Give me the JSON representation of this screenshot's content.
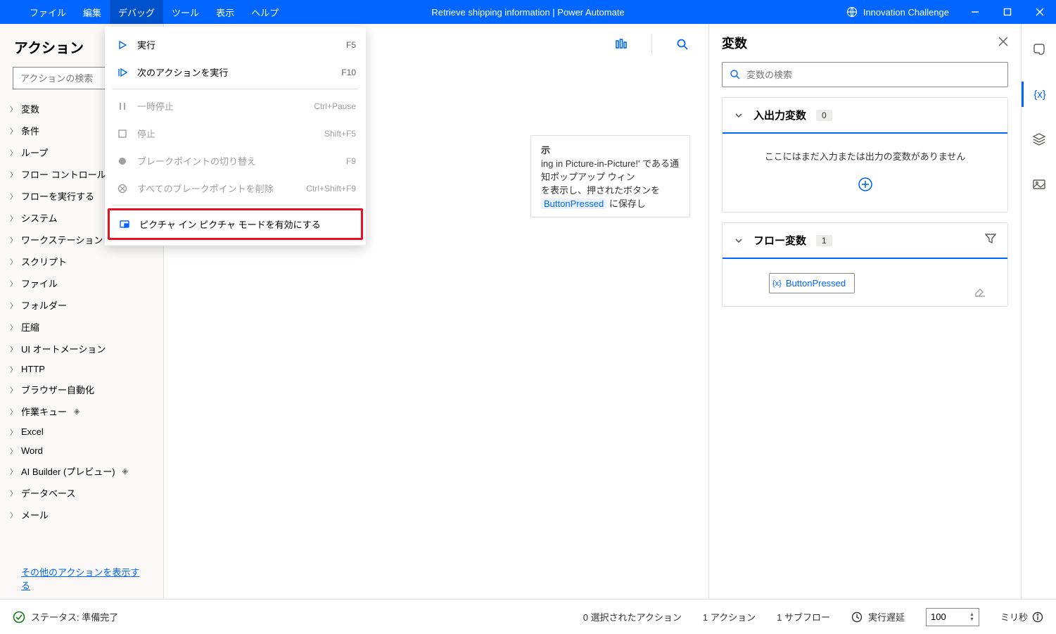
{
  "titlebar": {
    "menus": [
      "ファイル",
      "編集",
      "デバッグ",
      "ツール",
      "表示",
      "ヘルプ"
    ],
    "active_menu_index": 2,
    "title": "Retrieve shipping information | Power Automate",
    "environment": "Innovation Challenge"
  },
  "actions": {
    "title": "アクション",
    "search_placeholder": "アクションの検索",
    "groups": [
      "変数",
      "条件",
      "ループ",
      "フロー コントロール",
      "フローを実行する",
      "システム",
      "ワークステーション",
      "スクリプト",
      "ファイル",
      "フォルダー",
      "圧縮",
      "UI オートメーション",
      "HTTP",
      "ブラウザー自動化",
      "作業キュー",
      "Excel",
      "Word",
      "AI Builder (プレビュー)",
      "データベース",
      "メール"
    ],
    "premium_indices": [
      14,
      17
    ],
    "more_link": "その他のアクションを表示する"
  },
  "dropdown": {
    "items": [
      {
        "label": "実行",
        "shortcut": "F5",
        "icon": "play",
        "enabled": true
      },
      {
        "label": "次のアクションを実行",
        "shortcut": "F10",
        "icon": "step",
        "enabled": true
      },
      {
        "sep": true
      },
      {
        "label": "一時停止",
        "shortcut": "Ctrl+Pause",
        "icon": "pause",
        "enabled": false
      },
      {
        "label": "停止",
        "shortcut": "Shift+F5",
        "icon": "stop",
        "enabled": false
      },
      {
        "label": "ブレークポイントの切り替え",
        "shortcut": "F9",
        "icon": "bp",
        "enabled": false
      },
      {
        "label": "すべてのブレークポイントを削除",
        "shortcut": "Ctrl+Shift+F9",
        "icon": "bpdel",
        "enabled": false
      },
      {
        "sep": true
      },
      {
        "label": "ピクチャ イン ピクチャ モードを有効にする",
        "shortcut": "",
        "icon": "pip",
        "enabled": true,
        "highlighted": true
      }
    ]
  },
  "canvas": {
    "card_prefix_text": "示",
    "card_text_1": "ing in Picture-in-Picture!' である通知ポップアップ ウィン",
    "card_text_2": "を表示し、押されたボタンを ",
    "card_var": "ButtonPressed",
    "card_text_3": " に保存し"
  },
  "variables": {
    "title": "変数",
    "search_placeholder": "変数の検索",
    "io_section": {
      "title": "入出力変数",
      "count": "0",
      "empty": "ここにはまだ入力または出力の変数がありません"
    },
    "flow_section": {
      "title": "フロー変数",
      "count": "1",
      "var_name": "ButtonPressed"
    }
  },
  "statusbar": {
    "status": "ステータス: 準備完了",
    "selected": "0 選択されたアクション",
    "actions": "1 アクション",
    "subflows": "1 サブフロー",
    "delay_label": "実行遅延",
    "delay_value": "100",
    "ms": "ミリ秒"
  }
}
